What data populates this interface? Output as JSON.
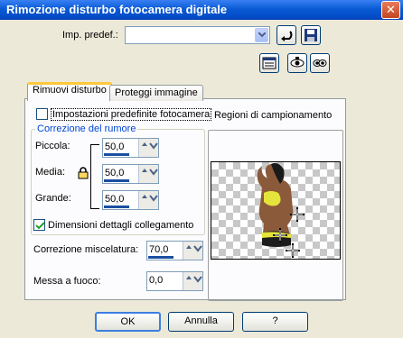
{
  "window": {
    "title": "Rimozione disturbo fotocamera digitale",
    "close_label": "✕"
  },
  "preset": {
    "label": "Imp. predef.:",
    "value": ""
  },
  "tabs": [
    {
      "label": "Rimuovi disturbo",
      "active": true
    },
    {
      "label": "Proteggi immagine",
      "active": false
    }
  ],
  "settings": {
    "defaults_checkbox_label": "Impostazioni predefinite fotocamera",
    "defaults_checked": false,
    "correction_group_title": "Correzione del rumore",
    "small_label": "Piccola:",
    "small_value": "50,0",
    "medium_label": "Media:",
    "medium_value": "50,0",
    "large_label": "Grande:",
    "large_value": "50,0",
    "link_checkbox_label": "Dimensioni dettagli collegamento",
    "link_checked": true,
    "blend_label": "Correzione miscelatura:",
    "blend_value": "70,0",
    "focus_label": "Messa a fuoco:",
    "focus_value": "0,0"
  },
  "sampling": {
    "title": "Regioni di campionamento"
  },
  "buttons": {
    "ok": "OK",
    "cancel": "Annulla",
    "help": "?"
  },
  "colors": {
    "accent": "#0a5bd6",
    "group_title": "#0046d5",
    "tab_highlight": "#ffc83c"
  }
}
